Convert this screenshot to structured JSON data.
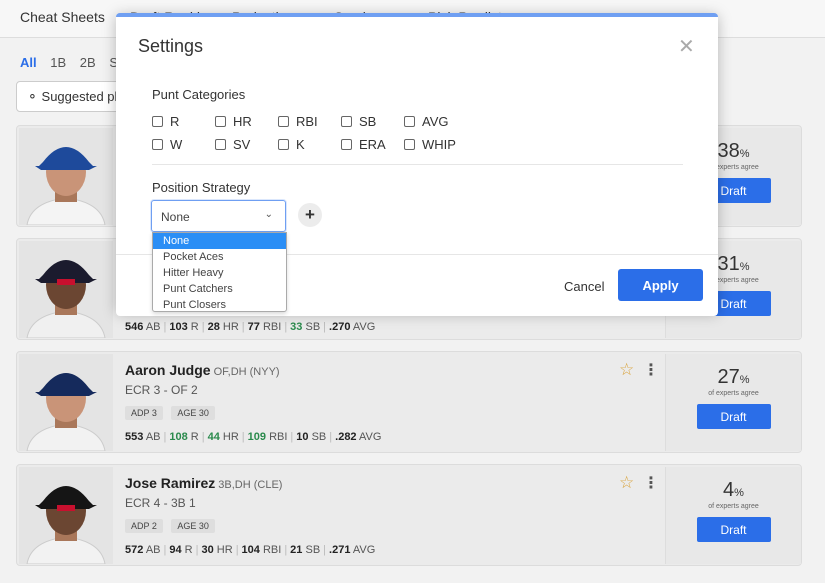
{
  "nav": {
    "items": [
      "Cheat Sheets",
      "Draft Rankings",
      "Projections",
      "Scoring",
      "Pick Predictor"
    ]
  },
  "filters": {
    "tabs": [
      "All",
      "1B",
      "2B",
      "SS"
    ],
    "suggested_label": "Suggested pl"
  },
  "players": [
    {
      "name": "",
      "pos": "",
      "ecr": "",
      "adp": "",
      "age": "",
      "stats": [],
      "pct": "38",
      "agree": "of experts agree",
      "draft": "Draft"
    },
    {
      "name": "",
      "pos": "",
      "ecr": "",
      "adp": "",
      "age": "",
      "stats": [
        {
          "v": "546",
          "l": "AB"
        },
        {
          "v": "103",
          "l": "R"
        },
        {
          "v": "28",
          "l": "HR"
        },
        {
          "v": "77",
          "l": "RBI"
        },
        {
          "v": "33",
          "l": "SB",
          "good": true
        },
        {
          "v": ".270",
          "l": "AVG"
        }
      ],
      "pct": "31",
      "agree": "of experts agree",
      "draft": "Draft"
    },
    {
      "name": "Aaron Judge",
      "pos": "OF,DH (NYY)",
      "ecr": "ECR 3 - OF 2",
      "adp": "ADP 3",
      "age": "AGE 30",
      "stats": [
        {
          "v": "553",
          "l": "AB"
        },
        {
          "v": "108",
          "l": "R",
          "good": true
        },
        {
          "v": "44",
          "l": "HR",
          "good": true
        },
        {
          "v": "109",
          "l": "RBI",
          "good": true
        },
        {
          "v": "10",
          "l": "SB"
        },
        {
          "v": ".282",
          "l": "AVG"
        }
      ],
      "pct": "27",
      "agree": "of experts agree",
      "draft": "Draft"
    },
    {
      "name": "Jose Ramirez",
      "pos": "3B,DH (CLE)",
      "ecr": "ECR 4 - 3B 1",
      "adp": "ADP 2",
      "age": "AGE 30",
      "stats": [
        {
          "v": "572",
          "l": "AB"
        },
        {
          "v": "94",
          "l": "R"
        },
        {
          "v": "30",
          "l": "HR"
        },
        {
          "v": "104",
          "l": "RBI"
        },
        {
          "v": "21",
          "l": "SB"
        },
        {
          "v": ".271",
          "l": "AVG"
        }
      ],
      "pct": "4",
      "agree": "of experts agree",
      "draft": "Draft"
    }
  ],
  "modal": {
    "title": "Settings",
    "close_icon": "close-icon",
    "punt_label": "Punt Categories",
    "categories_row1": [
      "R",
      "HR",
      "RBI",
      "SB",
      "AVG"
    ],
    "categories_row2": [
      "W",
      "SV",
      "K",
      "ERA",
      "WHIP"
    ],
    "position_label": "Position Strategy",
    "select_value": "None",
    "options": [
      "None",
      "Pocket Aces",
      "Hitter Heavy",
      "Punt Catchers",
      "Punt Closers"
    ],
    "selected_option": "None",
    "cancel_label": "Cancel",
    "apply_label": "Apply"
  },
  "colors": {
    "accent": "#2b6ee8",
    "option_highlight": "#2b8ef5",
    "good_stat": "#2a8a4c",
    "star": "#d9a33b"
  }
}
